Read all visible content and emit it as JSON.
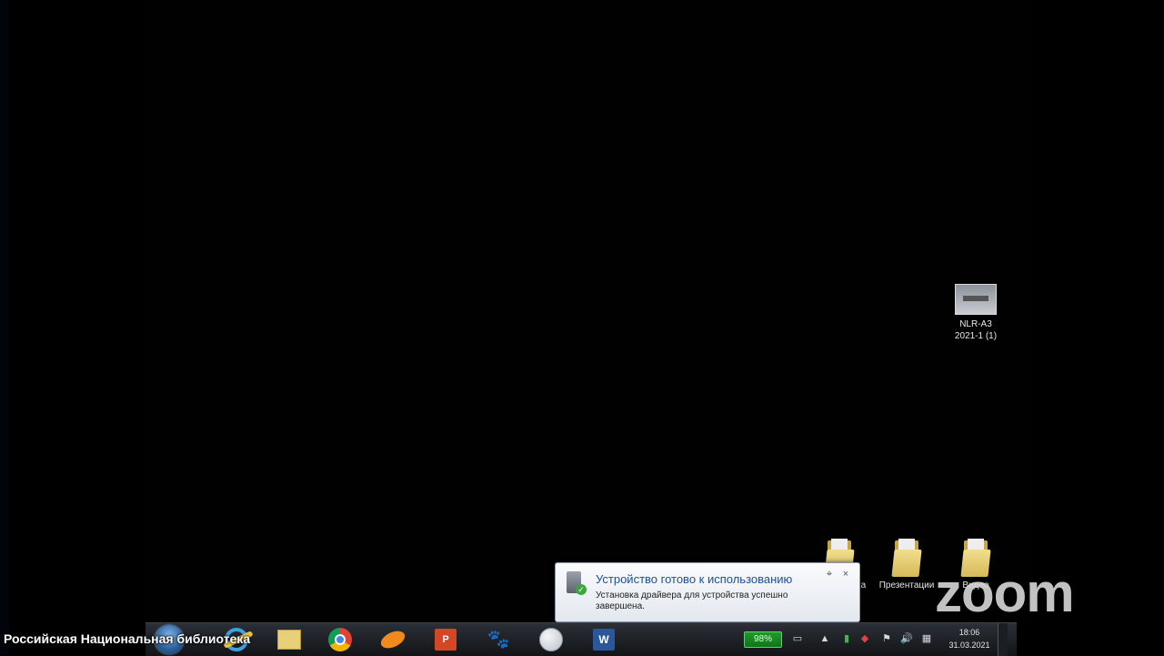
{
  "desktop": {
    "top_icon": {
      "label_line1": "NLR-A3",
      "label_line2": "2021-1 (1)"
    },
    "folders": [
      {
        "label": "Новая папка"
      },
      {
        "label": "Презентации"
      },
      {
        "label": "Видео"
      }
    ]
  },
  "notification": {
    "title": "Устройство готово к использованию",
    "body": "Установка драйвера для устройства успешно завершена.",
    "pin_icon": "pin-icon",
    "close_glyph": "×"
  },
  "taskbar": {
    "apps": [
      {
        "name": "start-orb",
        "icon": "windows-start-orb"
      },
      {
        "name": "internet-explorer",
        "icon": "ie-icon"
      },
      {
        "name": "file-explorer",
        "icon": "folder-icon"
      },
      {
        "name": "chrome",
        "icon": "chrome-icon"
      },
      {
        "name": "orange-app",
        "icon": "orange-app-icon"
      },
      {
        "name": "powerpoint",
        "icon": "powerpoint-icon",
        "glyph": "P"
      },
      {
        "name": "paw-app",
        "icon": "paw-icon",
        "glyph": "🐾"
      },
      {
        "name": "paint-app",
        "icon": "paint-icon"
      },
      {
        "name": "word",
        "icon": "word-icon",
        "glyph": "W"
      }
    ],
    "tray": {
      "battery": "98%",
      "expand_glyph": "▲",
      "clock_time": "18:06",
      "clock_date": "31.03.2021"
    }
  },
  "overlay": {
    "caption": "Российская Национальная библиотека",
    "zoom_logo": "zoom"
  }
}
